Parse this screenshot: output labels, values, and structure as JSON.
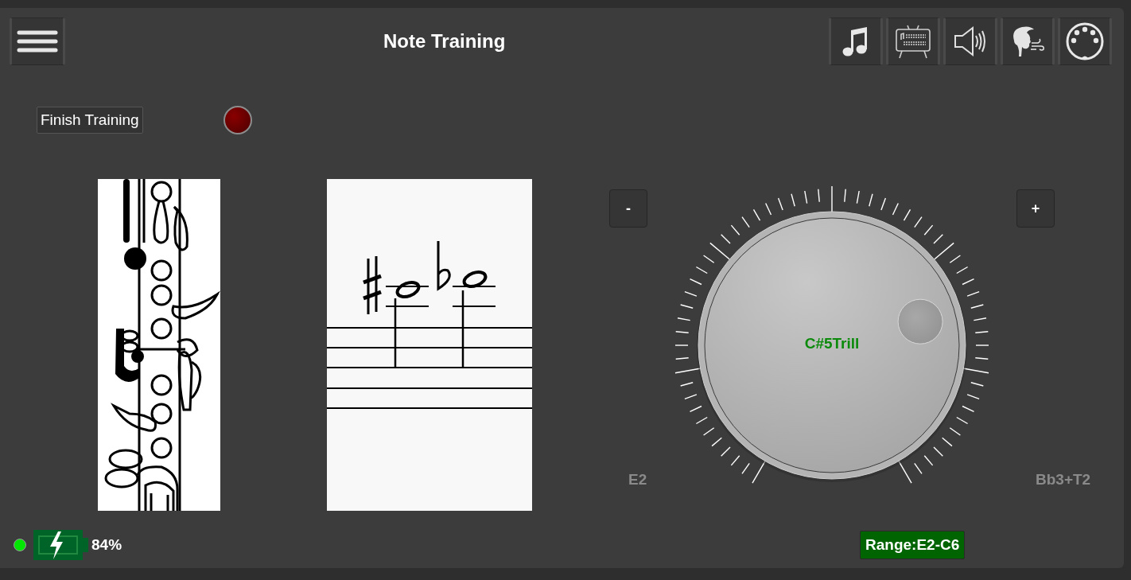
{
  "header": {
    "title": "Note Training"
  },
  "controls": {
    "finish_button": "Finish Training"
  },
  "knob": {
    "minus": "-",
    "plus": "+",
    "value_label": "C#5Trill",
    "level": 0.75,
    "min_label": "E2",
    "max_label": "Bb3+T2"
  },
  "status_bar": {
    "connected": true,
    "battery": "84%",
    "range": "Range:E2-C6"
  }
}
